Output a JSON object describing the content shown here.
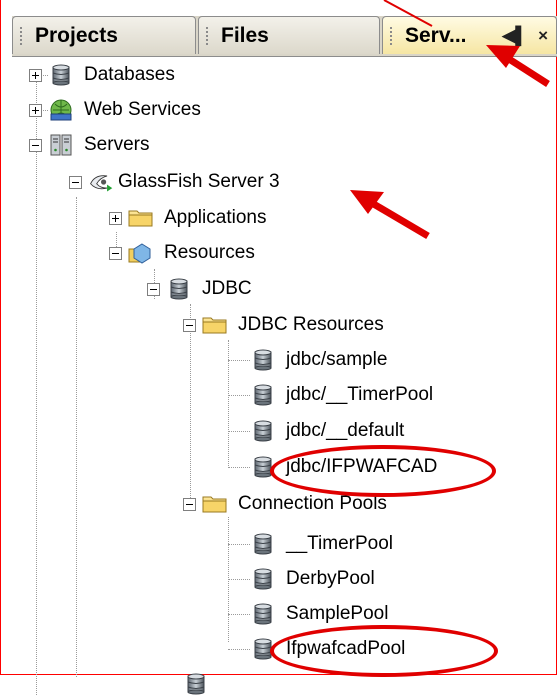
{
  "tabs": [
    {
      "label": "Projects"
    },
    {
      "label": "Files"
    },
    {
      "label": "Serv..."
    }
  ],
  "tab_controls": {
    "scroll": "◀▌",
    "close": "×"
  },
  "tree": [
    {
      "label": "Databases",
      "icon": "database-icon"
    },
    {
      "label": "Web Services",
      "icon": "web-services-icon"
    },
    {
      "label": "Servers",
      "icon": "servers-icon"
    },
    {
      "label": "GlassFish Server 3",
      "icon": "glassfish-server-icon"
    },
    {
      "label": "Applications",
      "icon": "folder-icon"
    },
    {
      "label": "Resources",
      "icon": "resources-icon"
    },
    {
      "label": "JDBC",
      "icon": "database-icon"
    },
    {
      "label": "JDBC Resources",
      "icon": "folder-icon"
    },
    {
      "label": "jdbc/sample",
      "icon": "database-icon"
    },
    {
      "label": "jdbc/__TimerPool",
      "icon": "database-icon"
    },
    {
      "label": "jdbc/__default",
      "icon": "database-icon"
    },
    {
      "label": "jdbc/IFPWAFCAD",
      "icon": "database-icon"
    },
    {
      "label": "Connection Pools",
      "icon": "folder-icon"
    },
    {
      "label": "__TimerPool",
      "icon": "database-icon"
    },
    {
      "label": "DerbyPool",
      "icon": "database-icon"
    },
    {
      "label": "SamplePool",
      "icon": "database-icon"
    },
    {
      "label": "IfpwafcadPool",
      "icon": "database-icon"
    }
  ],
  "colors": {
    "annotation": "#e00000",
    "tab_active": "#f6e6a3",
    "tree_line": "#9a9a9a"
  }
}
